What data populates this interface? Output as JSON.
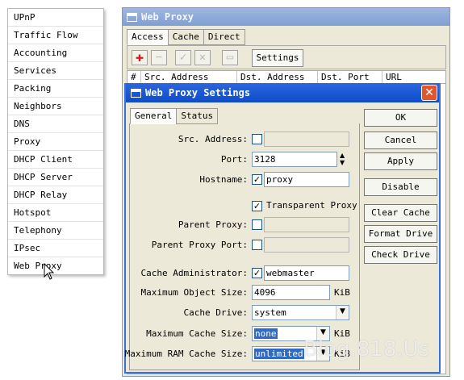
{
  "menu": {
    "items": [
      "UPnP",
      "Traffic Flow",
      "Accounting",
      "Services",
      "Packing",
      "Neighbors",
      "DNS",
      "Proxy",
      "DHCP Client",
      "DHCP Server",
      "DHCP Relay",
      "Hotspot",
      "Telephony",
      "IPsec",
      "Web Proxy"
    ]
  },
  "proxy_window": {
    "title": "Web Proxy",
    "tabs": [
      "Access",
      "Cache",
      "Direct"
    ],
    "toolbar": {
      "icons": [
        "add-icon",
        "remove-icon",
        "enable-icon",
        "disable-icon",
        "comment-icon"
      ],
      "settings_label": "Settings"
    },
    "columns": [
      "#",
      "Src. Address",
      "Dst. Address",
      "Dst. Port",
      "URL"
    ]
  },
  "settings_dialog": {
    "title": "Web Proxy Settings",
    "close_label": "✕",
    "tabs": [
      "General",
      "Status"
    ],
    "fields": {
      "src_address": {
        "label": "Src. Address:",
        "value": ""
      },
      "port": {
        "label": "Port:",
        "value": "3128"
      },
      "hostname": {
        "label": "Hostname:",
        "value": "proxy"
      },
      "transparent": {
        "label": "Transparent Proxy",
        "checked": true
      },
      "parent_proxy": {
        "label": "Parent Proxy:",
        "value": ""
      },
      "parent_proxy_port": {
        "label": "Parent Proxy Port:",
        "value": ""
      },
      "cache_admin": {
        "label": "Cache Administrator:",
        "value": "webmaster"
      },
      "max_object_size": {
        "label": "Maximum Object Size:",
        "value": "4096",
        "unit": "KiB"
      },
      "cache_drive": {
        "label": "Cache Drive:",
        "value": "system"
      },
      "max_cache_size": {
        "label": "Maximum Cache Size:",
        "value": "none",
        "unit": "KiB"
      },
      "max_ram_cache_size": {
        "label": "Maximum RAM Cache Size:",
        "value": "unlimited",
        "unit": "KiB"
      }
    },
    "buttons": [
      "OK",
      "Cancel",
      "Apply",
      "Disable",
      "Clear Cache",
      "Format Drive",
      "Check Drive"
    ]
  },
  "watermark": "Blog.818.Us"
}
